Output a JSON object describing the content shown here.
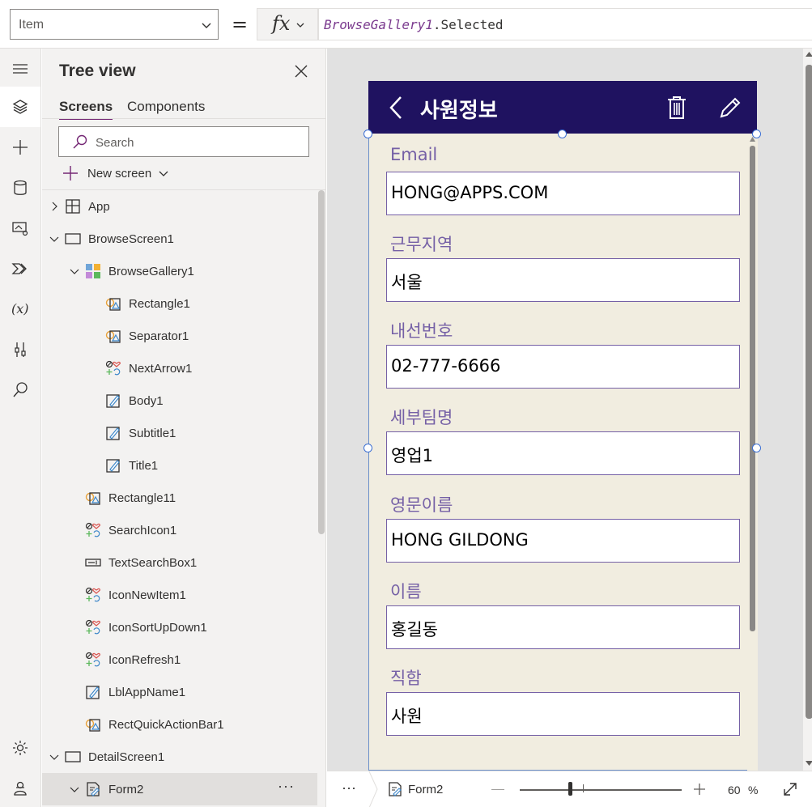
{
  "formula_bar": {
    "property": "Item",
    "fx_label": "fx",
    "formula_control": "BrowseGallery1",
    "formula_rest": ".Selected",
    "equals": "="
  },
  "rail": {
    "icons": [
      "hamburger-icon",
      "layers-icon",
      "plus-icon",
      "database-icon",
      "media-icon",
      "power-automate-icon",
      "variables-icon",
      "tools-icon",
      "search-icon",
      "settings-icon",
      "account-icon"
    ]
  },
  "tree": {
    "title": "Tree view",
    "tabs": {
      "screens": "Screens",
      "components": "Components"
    },
    "search_placeholder": "Search",
    "new_screen": "New screen",
    "items": [
      {
        "label": "App",
        "icon": "app-icon"
      },
      {
        "label": "BrowseScreen1",
        "icon": "screen-icon"
      },
      {
        "label": "BrowseGallery1",
        "icon": "gallery-icon"
      },
      {
        "label": "Rectangle1",
        "icon": "shape-icon"
      },
      {
        "label": "Separator1",
        "icon": "shape-icon"
      },
      {
        "label": "NextArrow1",
        "icon": "icons-icon"
      },
      {
        "label": "Body1",
        "icon": "label-icon"
      },
      {
        "label": "Subtitle1",
        "icon": "label-icon"
      },
      {
        "label": "Title1",
        "icon": "label-icon"
      },
      {
        "label": "Rectangle11",
        "icon": "shape-icon"
      },
      {
        "label": "SearchIcon1",
        "icon": "icons-icon"
      },
      {
        "label": "TextSearchBox1",
        "icon": "textinput-icon"
      },
      {
        "label": "IconNewItem1",
        "icon": "icons-icon"
      },
      {
        "label": "IconSortUpDown1",
        "icon": "icons-icon"
      },
      {
        "label": "IconRefresh1",
        "icon": "icons-icon"
      },
      {
        "label": "LblAppName1",
        "icon": "label-icon"
      },
      {
        "label": "RectQuickActionBar1",
        "icon": "shape-icon"
      },
      {
        "label": "DetailScreen1",
        "icon": "screen-icon"
      },
      {
        "label": "Form2",
        "icon": "form-icon",
        "selected": true,
        "more": "···"
      }
    ]
  },
  "app": {
    "screen_title": "사원정보",
    "header_color": "#1f1260",
    "fields": [
      {
        "label": "Email",
        "value": "HONG@APPS.COM"
      },
      {
        "label": "근무지역",
        "value": "서울"
      },
      {
        "label": "내선번호",
        "value": "02-777-6666"
      },
      {
        "label": "세부팀명",
        "value": "영업1"
      },
      {
        "label": "영문이름",
        "value": "HONG GILDONG"
      },
      {
        "label": "이름",
        "value": "홍길동"
      },
      {
        "label": "직함",
        "value": "사원"
      }
    ]
  },
  "bottom_bar": {
    "more": "···",
    "selected_control": "Form2",
    "zoom_value": "60",
    "zoom_unit": "%"
  },
  "colors": {
    "accent": "#742774",
    "field_label": "#7560a6",
    "form_background": "#f1ede0",
    "selection_handle": "#3b6fd4"
  }
}
